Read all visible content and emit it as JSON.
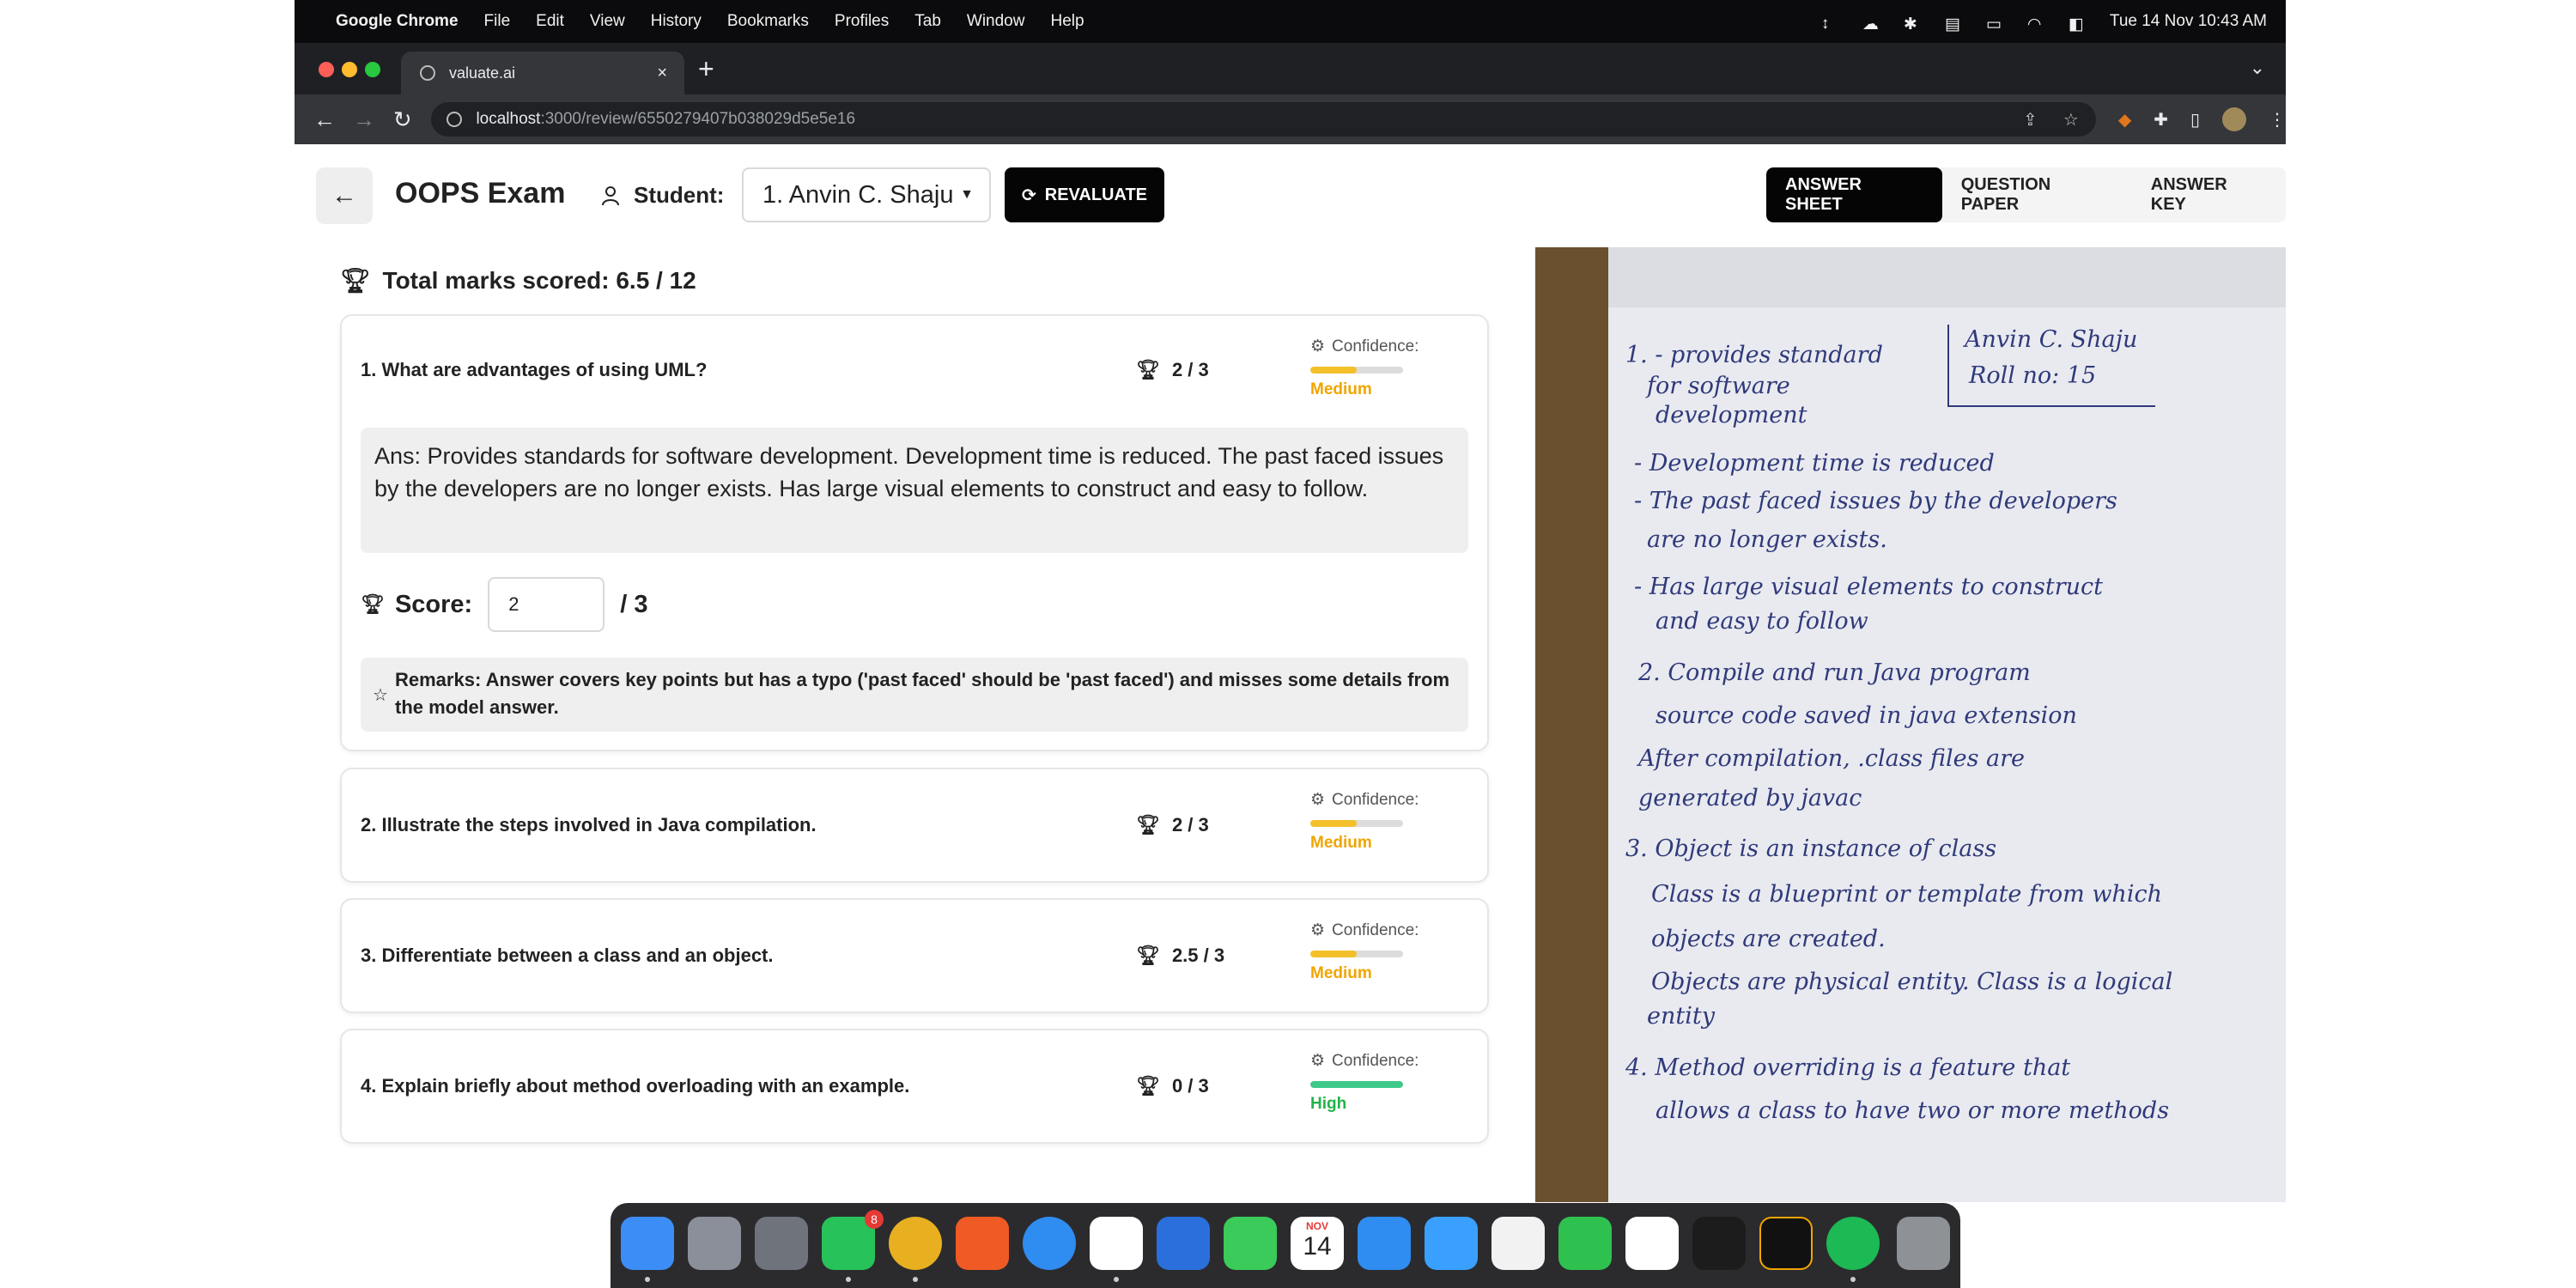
{
  "menubar": {
    "app_name": "Google Chrome",
    "items": [
      "File",
      "Edit",
      "View",
      "History",
      "Bookmarks",
      "Profiles",
      "Tab",
      "Window",
      "Help"
    ],
    "clock": "Tue 14 Nov  10:43 AM"
  },
  "browser": {
    "tab_title": "valuate.ai",
    "url_host": "localhost",
    "url_path": ":3000/review/6550279407b038029d5e5e16"
  },
  "header": {
    "exam_title": "OOPS Exam",
    "student_label": "Student:",
    "student_selected": "1. Anvin C. Shaju",
    "revaluate_label": "REVALUATE",
    "tabs": [
      {
        "label": "ANSWER SHEET",
        "active": true
      },
      {
        "label": "QUESTION PAPER",
        "active": false
      },
      {
        "label": "ANSWER KEY",
        "active": false
      }
    ]
  },
  "summary": {
    "total_label": "Total marks scored: 6.5 / 12"
  },
  "questions": [
    {
      "title": "1. What are advantages of using UML?",
      "marks": "2 / 3",
      "confidence_label": "Confidence:",
      "confidence_level": "Medium",
      "confidence_fraction": 0.5,
      "answer": "Ans: Provides standards for software development. Development time is reduced. The past faced issues by the developers are no longer exists. Has large visual elements to construct and easy to follow.",
      "score_label": "Score:",
      "score_value": "2",
      "score_max": "/ 3",
      "remarks": "Remarks: Answer covers key points but has a typo ('past faced' should be 'past faced') and misses some details from the model answer."
    },
    {
      "title": "2. Illustrate the steps involved in Java compilation.",
      "marks": "2 / 3",
      "confidence_label": "Confidence:",
      "confidence_level": "Medium",
      "confidence_fraction": 0.5
    },
    {
      "title": "3. Differentiate between a class and an object.",
      "marks": "2.5 / 3",
      "confidence_label": "Confidence:",
      "confidence_level": "Medium",
      "confidence_fraction": 0.5
    },
    {
      "title": "4. Explain briefly about method overloading with an example.",
      "marks": "0 / 3",
      "confidence_label": "Confidence:",
      "confidence_level": "High",
      "confidence_fraction": 1.0
    }
  ],
  "colors": {
    "medium": "#f0a500",
    "medium_bar": "#f4c02a",
    "high": "#22b34a",
    "high_bar": "#3ec98a",
    "black_button": "#050505"
  },
  "answer_sheet": {
    "lines": [
      "1. - provides standard",
      "for software",
      "development",
      "- Development time is reduced",
      "- The past faced issues by the developers",
      "are no longer exists.",
      "- Has large visual elements to construct",
      "and easy to follow",
      "2. Compile and run Java program",
      "source code saved in java extension",
      "After compilation, .class files are",
      "generated by javac",
      "3. Object is an instance of class",
      "Class is a blueprint or template from which",
      "objects are created.",
      "Objects are physical entity. Class is a logical",
      "entity",
      "4. Method overriding is a feature that",
      "allows a class to have two or more methods"
    ],
    "name": "Anvin C. Shaju",
    "roll": "Roll no: 15"
  },
  "dock": {
    "date_month": "NOV",
    "date_day": "14",
    "whatsapp_badge": "8"
  }
}
